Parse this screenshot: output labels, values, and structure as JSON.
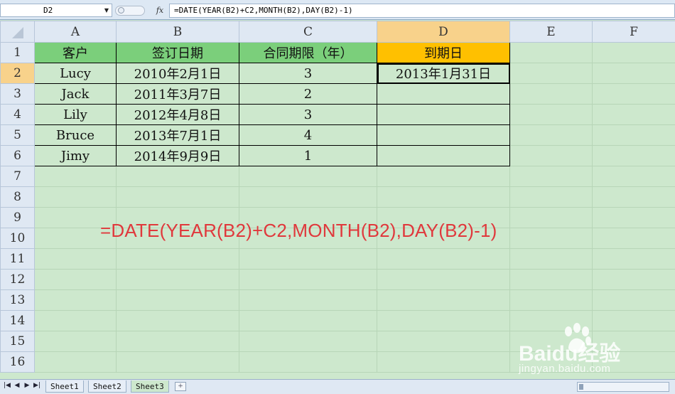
{
  "formula_bar": {
    "name_box": "D2",
    "fx_label": "fx",
    "formula": "=DATE(YEAR(B2)+C2,MONTH(B2),DAY(B2)-1)"
  },
  "columns": [
    "A",
    "B",
    "C",
    "D",
    "E",
    "F"
  ],
  "rows": [
    "1",
    "2",
    "3",
    "4",
    "5",
    "6",
    "7",
    "8",
    "9",
    "10",
    "11",
    "12",
    "13",
    "14",
    "15",
    "16"
  ],
  "table": {
    "headers": [
      "客户",
      "签订日期",
      "合同期限（年）",
      "到期日"
    ],
    "records": [
      [
        "Lucy",
        "2010年2月1日",
        "3",
        "2013年1月31日"
      ],
      [
        "Jack",
        "2011年3月7日",
        "2",
        ""
      ],
      [
        "Lily",
        "2012年4月8日",
        "3",
        ""
      ],
      [
        "Bruce",
        "2013年7月1日",
        "4",
        ""
      ],
      [
        "Jimy",
        "2014年9月9日",
        "1",
        ""
      ]
    ]
  },
  "annotation": "=DATE(YEAR(B2)+C2,MONTH(B2),DAY(B2)-1)",
  "sheets": [
    "Sheet1",
    "Sheet2",
    "Sheet3"
  ],
  "active_sheet": "Sheet3",
  "watermark": {
    "brand": "Baidu经验",
    "url": "jingyan.baidu.com"
  },
  "colors": {
    "header_green": "#7bcf7b",
    "header_orange": "#ffc000",
    "annotation_red": "#e0383c",
    "sheet_background": "#cde8cd"
  }
}
